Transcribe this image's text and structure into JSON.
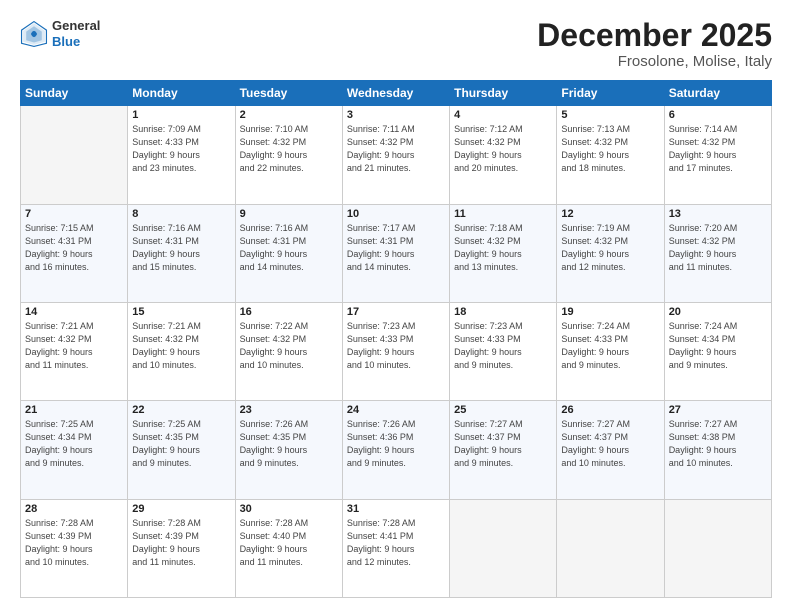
{
  "header": {
    "logo_general": "General",
    "logo_blue": "Blue",
    "month_title": "December 2025",
    "location": "Frosolone, Molise, Italy"
  },
  "days_of_week": [
    "Sunday",
    "Monday",
    "Tuesday",
    "Wednesday",
    "Thursday",
    "Friday",
    "Saturday"
  ],
  "weeks": [
    [
      {
        "day": "",
        "info": ""
      },
      {
        "day": "1",
        "info": "Sunrise: 7:09 AM\nSunset: 4:33 PM\nDaylight: 9 hours\nand 23 minutes."
      },
      {
        "day": "2",
        "info": "Sunrise: 7:10 AM\nSunset: 4:32 PM\nDaylight: 9 hours\nand 22 minutes."
      },
      {
        "day": "3",
        "info": "Sunrise: 7:11 AM\nSunset: 4:32 PM\nDaylight: 9 hours\nand 21 minutes."
      },
      {
        "day": "4",
        "info": "Sunrise: 7:12 AM\nSunset: 4:32 PM\nDaylight: 9 hours\nand 20 minutes."
      },
      {
        "day": "5",
        "info": "Sunrise: 7:13 AM\nSunset: 4:32 PM\nDaylight: 9 hours\nand 18 minutes."
      },
      {
        "day": "6",
        "info": "Sunrise: 7:14 AM\nSunset: 4:32 PM\nDaylight: 9 hours\nand 17 minutes."
      }
    ],
    [
      {
        "day": "7",
        "info": "Sunrise: 7:15 AM\nSunset: 4:31 PM\nDaylight: 9 hours\nand 16 minutes."
      },
      {
        "day": "8",
        "info": "Sunrise: 7:16 AM\nSunset: 4:31 PM\nDaylight: 9 hours\nand 15 minutes."
      },
      {
        "day": "9",
        "info": "Sunrise: 7:16 AM\nSunset: 4:31 PM\nDaylight: 9 hours\nand 14 minutes."
      },
      {
        "day": "10",
        "info": "Sunrise: 7:17 AM\nSunset: 4:31 PM\nDaylight: 9 hours\nand 14 minutes."
      },
      {
        "day": "11",
        "info": "Sunrise: 7:18 AM\nSunset: 4:32 PM\nDaylight: 9 hours\nand 13 minutes."
      },
      {
        "day": "12",
        "info": "Sunrise: 7:19 AM\nSunset: 4:32 PM\nDaylight: 9 hours\nand 12 minutes."
      },
      {
        "day": "13",
        "info": "Sunrise: 7:20 AM\nSunset: 4:32 PM\nDaylight: 9 hours\nand 11 minutes."
      }
    ],
    [
      {
        "day": "14",
        "info": "Sunrise: 7:21 AM\nSunset: 4:32 PM\nDaylight: 9 hours\nand 11 minutes."
      },
      {
        "day": "15",
        "info": "Sunrise: 7:21 AM\nSunset: 4:32 PM\nDaylight: 9 hours\nand 10 minutes."
      },
      {
        "day": "16",
        "info": "Sunrise: 7:22 AM\nSunset: 4:32 PM\nDaylight: 9 hours\nand 10 minutes."
      },
      {
        "day": "17",
        "info": "Sunrise: 7:23 AM\nSunset: 4:33 PM\nDaylight: 9 hours\nand 10 minutes."
      },
      {
        "day": "18",
        "info": "Sunrise: 7:23 AM\nSunset: 4:33 PM\nDaylight: 9 hours\nand 9 minutes."
      },
      {
        "day": "19",
        "info": "Sunrise: 7:24 AM\nSunset: 4:33 PM\nDaylight: 9 hours\nand 9 minutes."
      },
      {
        "day": "20",
        "info": "Sunrise: 7:24 AM\nSunset: 4:34 PM\nDaylight: 9 hours\nand 9 minutes."
      }
    ],
    [
      {
        "day": "21",
        "info": "Sunrise: 7:25 AM\nSunset: 4:34 PM\nDaylight: 9 hours\nand 9 minutes."
      },
      {
        "day": "22",
        "info": "Sunrise: 7:25 AM\nSunset: 4:35 PM\nDaylight: 9 hours\nand 9 minutes."
      },
      {
        "day": "23",
        "info": "Sunrise: 7:26 AM\nSunset: 4:35 PM\nDaylight: 9 hours\nand 9 minutes."
      },
      {
        "day": "24",
        "info": "Sunrise: 7:26 AM\nSunset: 4:36 PM\nDaylight: 9 hours\nand 9 minutes."
      },
      {
        "day": "25",
        "info": "Sunrise: 7:27 AM\nSunset: 4:37 PM\nDaylight: 9 hours\nand 9 minutes."
      },
      {
        "day": "26",
        "info": "Sunrise: 7:27 AM\nSunset: 4:37 PM\nDaylight: 9 hours\nand 10 minutes."
      },
      {
        "day": "27",
        "info": "Sunrise: 7:27 AM\nSunset: 4:38 PM\nDaylight: 9 hours\nand 10 minutes."
      }
    ],
    [
      {
        "day": "28",
        "info": "Sunrise: 7:28 AM\nSunset: 4:39 PM\nDaylight: 9 hours\nand 10 minutes."
      },
      {
        "day": "29",
        "info": "Sunrise: 7:28 AM\nSunset: 4:39 PM\nDaylight: 9 hours\nand 11 minutes."
      },
      {
        "day": "30",
        "info": "Sunrise: 7:28 AM\nSunset: 4:40 PM\nDaylight: 9 hours\nand 11 minutes."
      },
      {
        "day": "31",
        "info": "Sunrise: 7:28 AM\nSunset: 4:41 PM\nDaylight: 9 hours\nand 12 minutes."
      },
      {
        "day": "",
        "info": ""
      },
      {
        "day": "",
        "info": ""
      },
      {
        "day": "",
        "info": ""
      }
    ]
  ]
}
